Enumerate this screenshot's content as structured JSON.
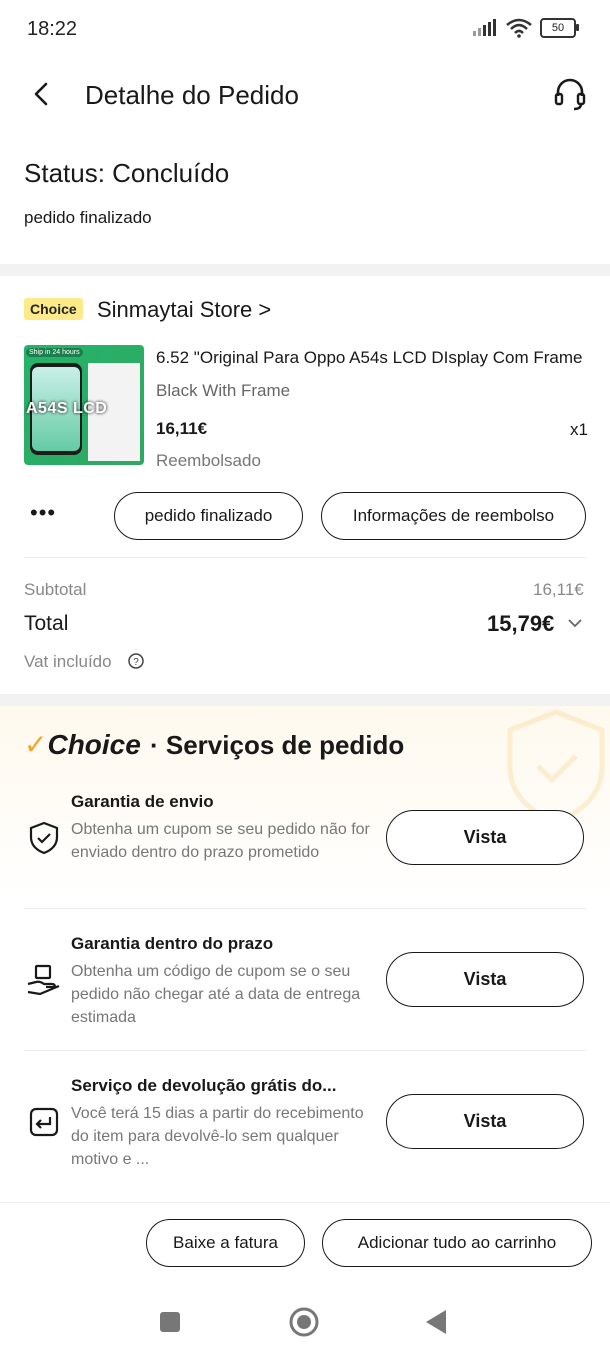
{
  "status_bar": {
    "time": "18:22",
    "battery": "50"
  },
  "header": {
    "title": "Detalhe do Pedido"
  },
  "order_status": {
    "title": "Status: Concluído",
    "subtitle": "pedido finalizado"
  },
  "store": {
    "badge": "Choice",
    "name": "Sinmaytai Store >"
  },
  "product": {
    "title": "6.52 \"Original Para Oppo A54s LCD DIsplay Com Frame",
    "variant": "Black With Frame",
    "price": "16,11€",
    "quantity": "x1",
    "status": "Reembolsado",
    "thumb_ship": "Ship in 24 hours",
    "thumb_label": "A54S LCD"
  },
  "actions": {
    "more": "•••",
    "finalized": "pedido finalizado",
    "refund_info": "Informações de reembolso"
  },
  "summary": {
    "subtotal_label": "Subtotal",
    "subtotal_value": "16,11€",
    "total_label": "Total",
    "total_value": "15,79€",
    "vat_label": "Vat incluído"
  },
  "services": {
    "brand": "Choice",
    "heading": "· Serviços de pedido",
    "items": [
      {
        "title": "Garantia de envio",
        "desc": "Obtenha um cupom se seu pedido não for enviado dentro do prazo prometido",
        "button": "Vista",
        "icon": "shield-check-icon"
      },
      {
        "title": "Garantia dentro do prazo",
        "desc": "Obtenha um código de cupom se o seu pedido não chegar até a data de entrega estimada",
        "button": "Vista",
        "icon": "hand-package-icon"
      },
      {
        "title": "Serviço de devolução grátis do...",
        "desc": "Você terá 15 dias a partir do recebimento do item para devolvê-lo sem qualquer motivo e ...",
        "button": "Vista",
        "icon": "return-icon"
      }
    ]
  },
  "bottom": {
    "invoice": "Baixe a fatura",
    "add_to_cart": "Adicionar tudo ao carrinho"
  },
  "colors": {
    "choice_yellow": "#fdeb8a",
    "choice_check": "#f5a623",
    "text": "#191919",
    "muted": "#888888"
  }
}
